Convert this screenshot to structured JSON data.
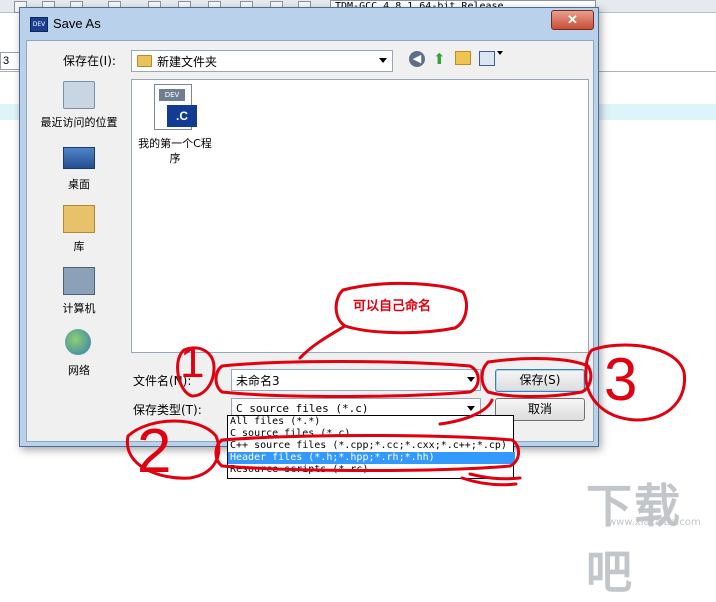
{
  "ide": {
    "compiler_label": "TDM-GCC 4.8.1 64-bit Release",
    "tab_label": "3"
  },
  "dialog": {
    "title": "Save As",
    "close_label": "✕",
    "save_in_label": "保存在(I):",
    "current_folder": "新建文件夹",
    "places": [
      {
        "label": "最近访问的位置",
        "icon": "recent-places-icon"
      },
      {
        "label": "桌面",
        "icon": "desktop-icon"
      },
      {
        "label": "库",
        "icon": "libraries-icon"
      },
      {
        "label": "计算机",
        "icon": "computer-icon"
      },
      {
        "label": "网络",
        "icon": "network-icon"
      }
    ],
    "files": [
      {
        "name": "我的第一个C程序",
        "icon_text": ".C",
        "icon_badge": "DEV"
      }
    ],
    "file_name_label": "文件名(N):",
    "file_name_value": "未命名3",
    "save_type_label": "保存类型(T):",
    "save_type_value": "C source files (*.c)",
    "save_button": "保存(S)",
    "cancel_button": "取消",
    "type_options": [
      "All files (*.*)",
      "C source files (*.c)",
      "C++ source files (*.cpp;*.cc;*.cxx;*.c++;*.cp)",
      "Header files (*.h;*.hpp;*.rh;*.hh)",
      "Resource scripts (*.rc)"
    ],
    "selected_type_index": 3
  },
  "annotations": {
    "note": "可以自己命名",
    "marks": [
      "1",
      "2",
      "3"
    ],
    "color": "#e1000f"
  },
  "watermark": {
    "main": "下载吧",
    "sub": "www.xiazaiba.com"
  }
}
